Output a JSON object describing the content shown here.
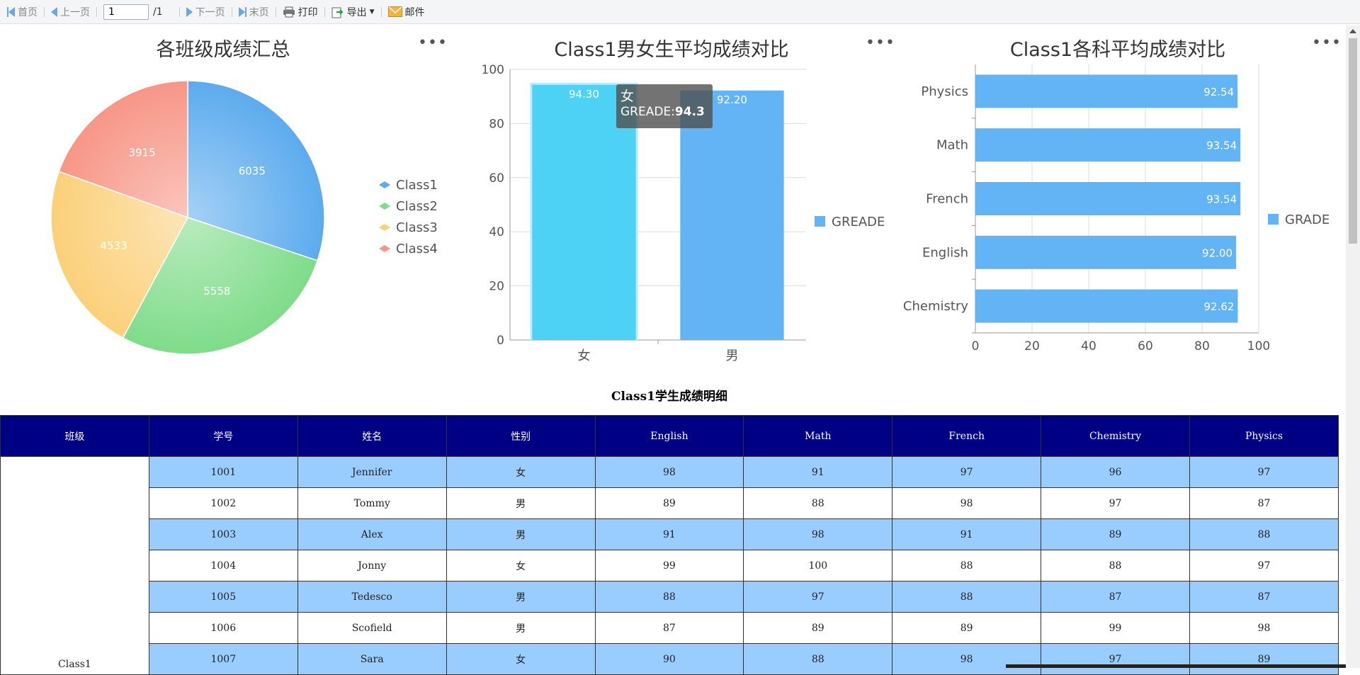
{
  "toolbar": {
    "first": "首页",
    "prev": "上一页",
    "page_value": "1",
    "page_total": "/1",
    "next": "下一页",
    "last": "末页",
    "print": "打印",
    "export": "导出",
    "mail": "邮件"
  },
  "more_label": "•••",
  "colors": {
    "class1": "#5cabee",
    "class2": "#7fdc8a",
    "class3": "#fbd07a",
    "class4": "#f79687",
    "bar": "#62b4f4",
    "bar_highlight": "#4dd2f5",
    "header_bg": "#000084",
    "row_alt": "#99ccff"
  },
  "chart_data": [
    {
      "type": "pie",
      "title": "各班级成绩汇总",
      "categories": [
        "Class1",
        "Class2",
        "Class3",
        "Class4"
      ],
      "values": [
        6035,
        5558,
        4533,
        3915
      ],
      "legend": "right"
    },
    {
      "type": "bar",
      "title": "Class1男女生平均成绩对比",
      "categories": [
        "女",
        "男"
      ],
      "series": [
        {
          "name": "GREADE",
          "values": [
            94.3,
            92.2
          ]
        }
      ],
      "value_labels": [
        "94.30",
        "92.20"
      ],
      "yticks": [
        "0",
        "20",
        "40",
        "60",
        "80",
        "100"
      ],
      "ylim": [
        0,
        100
      ],
      "legend": "right",
      "tooltip": {
        "category": "女",
        "series": "GREADE",
        "sep": ":",
        "value": "94.3"
      }
    },
    {
      "type": "bar",
      "orientation": "horizontal",
      "title": "Class1各科平均成绩对比",
      "categories": [
        "Physics",
        "Math",
        "French",
        "English",
        "Chemistry"
      ],
      "series": [
        {
          "name": "GRADE",
          "values": [
            92.54,
            93.54,
            93.54,
            92.0,
            92.62
          ]
        }
      ],
      "value_labels": [
        "92.54",
        "93.54",
        "93.54",
        "92.00",
        "92.62"
      ],
      "xticks": [
        "0",
        "20",
        "40",
        "60",
        "80",
        "100"
      ],
      "xlim": [
        0,
        100
      ],
      "legend": "right"
    }
  ],
  "table": {
    "title": "Class1学生成绩明细",
    "columns": [
      "班级",
      "学号",
      "姓名",
      "性别",
      "English",
      "Math",
      "French",
      "Chemistry",
      "Physics"
    ],
    "class_name": "Class1",
    "rows": [
      [
        "1001",
        "Jennifer",
        "女",
        "98",
        "91",
        "97",
        "96",
        "97"
      ],
      [
        "1002",
        "Tommy",
        "男",
        "89",
        "88",
        "98",
        "97",
        "87"
      ],
      [
        "1003",
        "Alex",
        "男",
        "91",
        "98",
        "91",
        "89",
        "88"
      ],
      [
        "1004",
        "Jonny",
        "女",
        "99",
        "100",
        "88",
        "88",
        "97"
      ],
      [
        "1005",
        "Tedesco",
        "男",
        "88",
        "97",
        "88",
        "87",
        "87"
      ],
      [
        "1006",
        "Scofield",
        "男",
        "87",
        "89",
        "89",
        "99",
        "98"
      ],
      [
        "1007",
        "Sara",
        "女",
        "90",
        "88",
        "98",
        "97",
        "89"
      ]
    ]
  }
}
